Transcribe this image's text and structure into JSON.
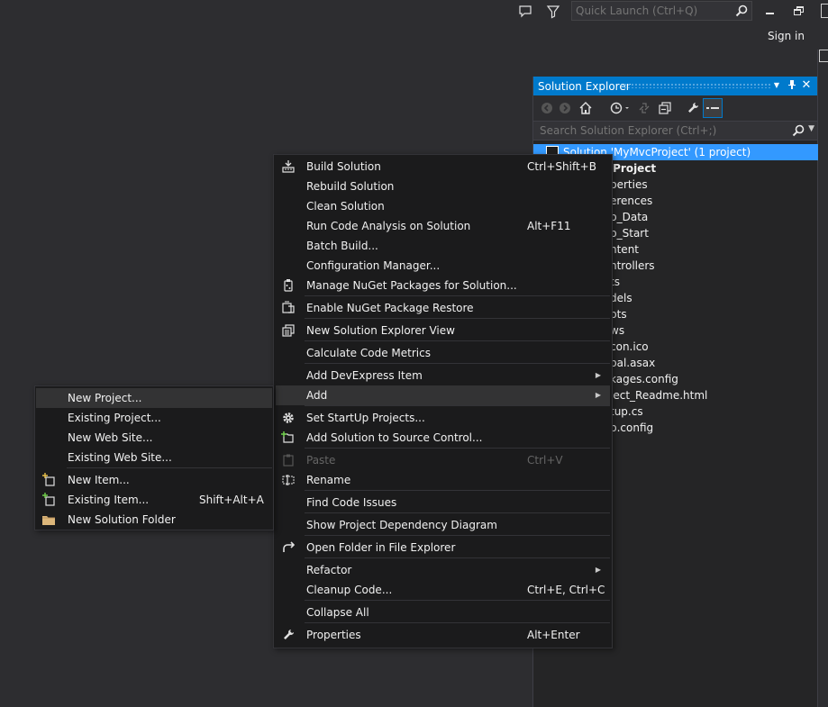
{
  "titlebar": {
    "quick_launch_placeholder": "Quick Launch (Ctrl+Q)",
    "sign_in": "Sign in"
  },
  "solution_explorer": {
    "title": "Solution Explorer",
    "search_placeholder": "Search Solution Explorer (Ctrl+;)",
    "tree": [
      {
        "label": "Solution 'MyMvcProject' (1 project)",
        "selected": true
      },
      {
        "label": "cProject",
        "bold": true
      },
      {
        "label": "perties"
      },
      {
        "label": "erences"
      },
      {
        "label": "p_Data"
      },
      {
        "label": "p_Start"
      },
      {
        "label": "ntent"
      },
      {
        "label": "ntrollers"
      },
      {
        "label": "ts"
      },
      {
        "label": "dels"
      },
      {
        "label": "pts"
      },
      {
        "label": "ws"
      },
      {
        "label": "con.ico"
      },
      {
        "label": "bal.asax"
      },
      {
        "label": "kages.config"
      },
      {
        "label": "ject_Readme.html"
      },
      {
        "label": "tup.cs"
      },
      {
        "label": "b.config"
      }
    ]
  },
  "context_menu": {
    "items": [
      {
        "label": "Build Solution",
        "shortcut": "Ctrl+Shift+B",
        "icon": "build-icon"
      },
      {
        "label": "Rebuild Solution",
        "shortcut": ""
      },
      {
        "label": "Clean Solution",
        "shortcut": ""
      },
      {
        "label": "Run Code Analysis on Solution",
        "shortcut": "Alt+F11"
      },
      {
        "label": "Batch Build...",
        "shortcut": ""
      },
      {
        "label": "Configuration Manager...",
        "shortcut": ""
      },
      {
        "label": "Manage NuGet Packages for Solution...",
        "shortcut": "",
        "icon": "nuget-icon"
      },
      {
        "label": "Enable NuGet Package Restore",
        "shortcut": "",
        "icon": "package-restore-icon"
      },
      {
        "label": "New Solution Explorer View",
        "shortcut": "",
        "icon": "new-view-icon"
      },
      {
        "label": "Calculate Code Metrics",
        "shortcut": ""
      },
      {
        "label": "Add DevExpress Item",
        "shortcut": "",
        "submenu": true
      },
      {
        "label": "Add",
        "shortcut": "",
        "submenu": true
      },
      {
        "label": "Set StartUp Projects...",
        "shortcut": "",
        "icon": "gear-icon"
      },
      {
        "label": "Add Solution to Source Control...",
        "shortcut": "",
        "icon": "source-control-icon"
      },
      {
        "label": "Paste",
        "shortcut": "Ctrl+V",
        "disabled": true,
        "icon": "paste-icon"
      },
      {
        "label": "Rename",
        "shortcut": "",
        "icon": "rename-icon"
      },
      {
        "label": "Find Code Issues",
        "shortcut": ""
      },
      {
        "label": "Show Project Dependency Diagram",
        "shortcut": ""
      },
      {
        "label": "Open Folder in File Explorer",
        "shortcut": "",
        "icon": "open-folder-arrow-icon"
      },
      {
        "label": "Refactor",
        "shortcut": "",
        "submenu": true
      },
      {
        "label": "Cleanup Code...",
        "shortcut": "Ctrl+E, Ctrl+C"
      },
      {
        "label": "Collapse All",
        "shortcut": ""
      },
      {
        "label": "Properties",
        "shortcut": "Alt+Enter",
        "icon": "wrench-icon"
      }
    ]
  },
  "add_menu": {
    "items": [
      {
        "label": "New Project...",
        "shortcut": ""
      },
      {
        "label": "Existing Project...",
        "shortcut": ""
      },
      {
        "label": "New Web Site...",
        "shortcut": ""
      },
      {
        "label": "Existing Web Site...",
        "shortcut": ""
      },
      {
        "label": "New Item...",
        "shortcut": "",
        "icon": "new-item-icon"
      },
      {
        "label": "Existing Item...",
        "shortcut": "Shift+Alt+A",
        "icon": "existing-item-icon"
      },
      {
        "label": "New Solution Folder",
        "shortcut": "",
        "icon": "folder-icon"
      }
    ]
  },
  "colors": {
    "accent": "#007acc",
    "selection": "#3399ff",
    "background": "#2d2d30",
    "menu_bg": "#1b1b1c"
  }
}
